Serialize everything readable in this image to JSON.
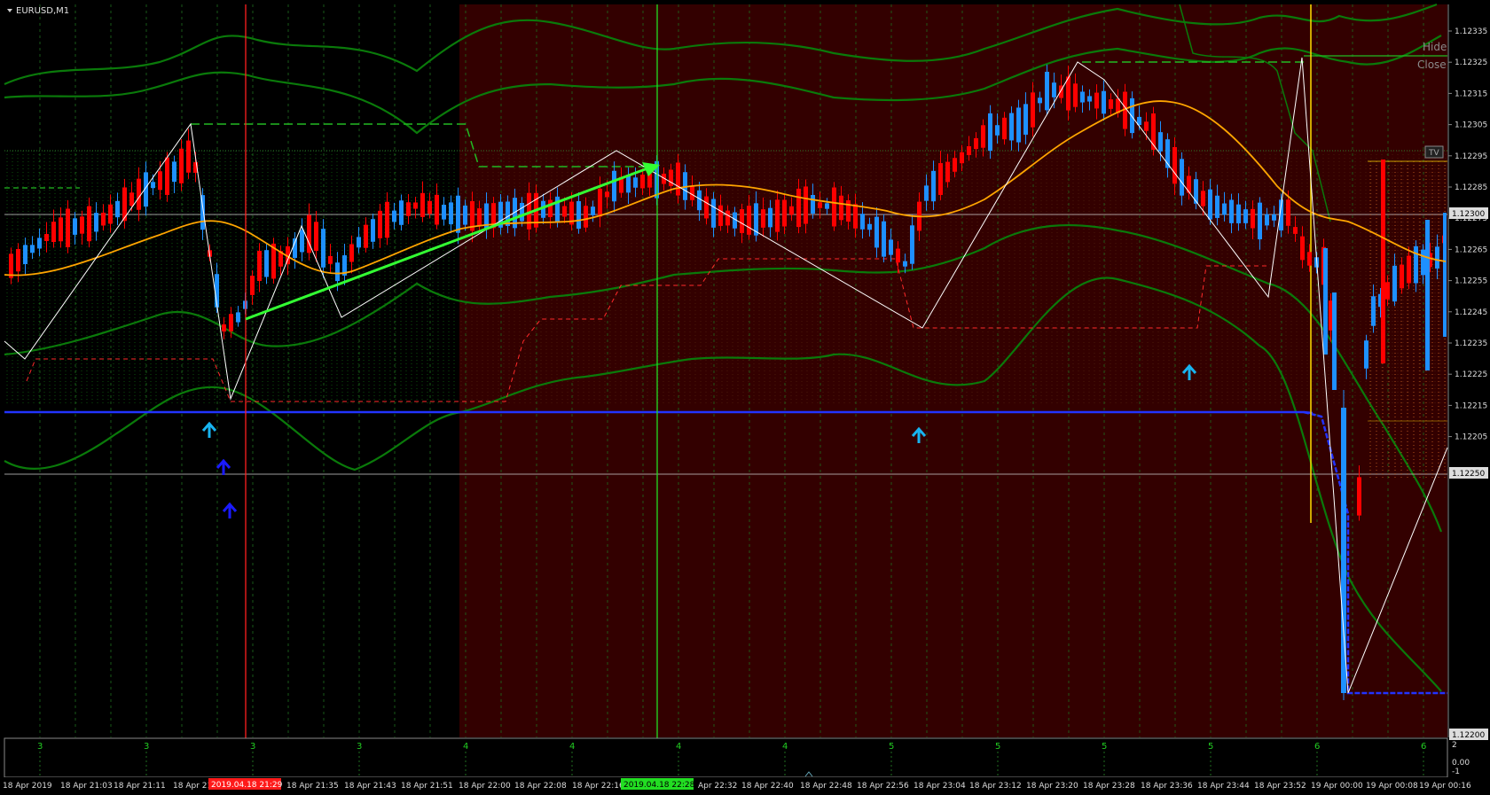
{
  "window": {
    "symbol_title": "EURUSD,M1",
    "hide_label": "Hide",
    "close_label": "Close",
    "tv_label": "TV"
  },
  "colors": {
    "background": "#000000",
    "session_shade": "#330000",
    "bull_candle": "#1e90ff",
    "bear_candle": "#ff0000",
    "moving_average": "#ffa500",
    "bands": "#0a7a0a",
    "zigzag": "#ffffff",
    "trend_arrow": "#33ff33",
    "support_line": "#2233ff",
    "vline_red": "#ff2020",
    "vline_green": "#22dd22",
    "arrow_cyan": "#18b4f0",
    "arrow_blue": "#1a1aff"
  },
  "price_axis": {
    "labels": [
      "1.12335",
      "1.12325",
      "1.12315",
      "1.12305",
      "1.12295",
      "1.12285",
      "1.12275",
      "1.12265",
      "1.12255",
      "1.12245",
      "1.12235",
      "1.12225",
      "1.12215",
      "1.12205"
    ],
    "current_price_box": "1.12300",
    "lower_price_box": "1.12250",
    "bottom_price_box": "1.12200"
  },
  "indicator_axis": {
    "labels": [
      "2",
      "0.00",
      "-1"
    ]
  },
  "indicator_pane": {
    "values": [
      "3",
      "3",
      "3",
      "3",
      "4",
      "4",
      "4",
      "4",
      "5",
      "5",
      "5",
      "5",
      "6",
      "6"
    ]
  },
  "time_axis": {
    "labels": [
      "18 Apr 2019",
      "18 Apr 21:03",
      "18 Apr 21:11",
      "18 Apr 21",
      "18 Apr 21:35",
      "18 Apr 21:43",
      "18 Apr 21:51",
      "18 Apr 22:00",
      "18 Apr 22:08",
      "18 Apr 22:16",
      "Apr 22:32",
      "18 Apr 22:40",
      "18 Apr 22:48",
      "18 Apr 22:56",
      "18 Apr 23:04",
      "18 Apr 23:12",
      "18 Apr 23:20",
      "18 Apr 23:28",
      "18 Apr 23:36",
      "18 Apr 23:44",
      "18 Apr 23:52",
      "19 Apr 00:00",
      "19 Apr 00:08",
      "19 Apr 00:16"
    ],
    "marker_red": "2019.04.18 21:29",
    "marker_green": "2019.04.18 22:28"
  }
}
